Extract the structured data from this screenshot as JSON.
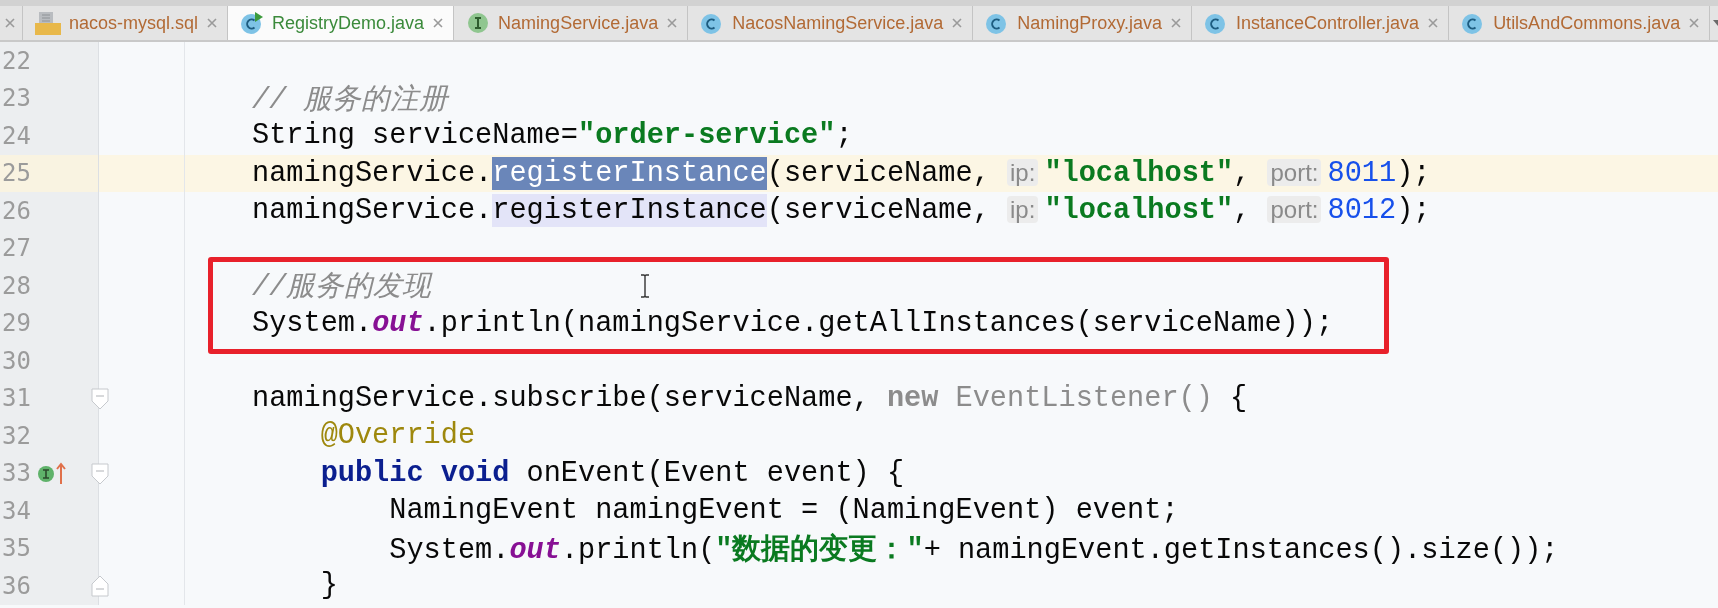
{
  "tabs": [
    {
      "label": "nacos-mysql.sql",
      "kind": "sql",
      "selected": false,
      "runnable": false,
      "color": "#b26a35"
    },
    {
      "label": "RegistryDemo.java",
      "kind": "class",
      "selected": true,
      "runnable": true,
      "color": "#3b8a3b"
    },
    {
      "label": "NamingService.java",
      "kind": "interface",
      "selected": false,
      "runnable": false,
      "color": "#b26a35"
    },
    {
      "label": "NacosNamingService.java",
      "kind": "class",
      "selected": false,
      "runnable": false,
      "color": "#b26a35"
    },
    {
      "label": "NamingProxy.java",
      "kind": "class",
      "selected": false,
      "runnable": false,
      "color": "#b26a35"
    },
    {
      "label": "InstanceController.java",
      "kind": "class",
      "selected": false,
      "runnable": false,
      "color": "#b26a35"
    },
    {
      "label": "UtilsAndCommons.java",
      "kind": "class",
      "selected": false,
      "runnable": false,
      "color": "#b26a35"
    }
  ],
  "editor": {
    "lines": [
      {
        "number": "22",
        "current": false,
        "boxed": false,
        "fold_start": false,
        "fold_end": false,
        "implements": false
      },
      {
        "number": "23",
        "current": false,
        "boxed": false,
        "fold_start": false,
        "fold_end": false,
        "implements": false,
        "tokens": [
          {
            "kind": "comment",
            "text": "// 服务的注册"
          }
        ]
      },
      {
        "number": "24",
        "current": false,
        "boxed": false,
        "fold_start": false,
        "fold_end": false,
        "implements": false,
        "tokens": [
          {
            "kind": "plain",
            "text": "String serviceName="
          },
          {
            "kind": "string",
            "text": "\"order-service\""
          },
          {
            "kind": "plain",
            "text": ";"
          }
        ]
      },
      {
        "number": "25",
        "current": true,
        "boxed": false,
        "fold_start": false,
        "fold_end": false,
        "implements": false,
        "tokens": [
          {
            "kind": "plain",
            "text": "namingService."
          },
          {
            "kind": "selected",
            "text": "registerInstance"
          },
          {
            "kind": "plain",
            "text": "(serviceName, "
          },
          {
            "kind": "hint",
            "text": "ip:"
          },
          {
            "kind": "string",
            "text": "\"localhost\""
          },
          {
            "kind": "plain",
            "text": ", "
          },
          {
            "kind": "hint",
            "text": "port:"
          },
          {
            "kind": "number",
            "text": "8011"
          },
          {
            "kind": "plain",
            "text": ");"
          }
        ]
      },
      {
        "number": "26",
        "current": false,
        "boxed": false,
        "fold_start": false,
        "fold_end": false,
        "implements": false,
        "tokens": [
          {
            "kind": "plain",
            "text": "namingService."
          },
          {
            "kind": "usage",
            "text": "registerInstance"
          },
          {
            "kind": "plain",
            "text": "(serviceName, "
          },
          {
            "kind": "hint",
            "text": "ip:"
          },
          {
            "kind": "string",
            "text": "\"localhost\""
          },
          {
            "kind": "plain",
            "text": ", "
          },
          {
            "kind": "hint",
            "text": "port:"
          },
          {
            "kind": "number",
            "text": "8012"
          },
          {
            "kind": "plain",
            "text": ");"
          }
        ]
      },
      {
        "number": "27",
        "current": false,
        "boxed": false,
        "fold_start": false,
        "fold_end": false,
        "implements": false
      },
      {
        "number": "28",
        "current": false,
        "boxed": true,
        "fold_start": false,
        "fold_end": false,
        "implements": false,
        "tokens": [
          {
            "kind": "comment",
            "text": "//服务的发现"
          }
        ]
      },
      {
        "number": "29",
        "current": false,
        "boxed": true,
        "fold_start": false,
        "fold_end": false,
        "implements": false,
        "tokens": [
          {
            "kind": "plain",
            "text": "System."
          },
          {
            "kind": "static",
            "text": "out"
          },
          {
            "kind": "plain",
            "text": ".println(namingService.getAllInstances(serviceName));"
          }
        ]
      },
      {
        "number": "30",
        "current": false,
        "boxed": false,
        "fold_start": false,
        "fold_end": false,
        "implements": false
      },
      {
        "number": "31",
        "current": false,
        "boxed": false,
        "fold_start": true,
        "fold_end": false,
        "implements": false,
        "tokens": [
          {
            "kind": "plain",
            "text": "namingService.subscribe(serviceName, "
          },
          {
            "kind": "muted-keyword",
            "text": "new"
          },
          {
            "kind": "muted",
            "text": " EventListener()"
          },
          {
            "kind": "plain",
            "text": " {"
          }
        ]
      },
      {
        "number": "32",
        "current": false,
        "boxed": false,
        "fold_start": false,
        "fold_end": false,
        "implements": false,
        "tokens": [
          {
            "kind": "annotation",
            "text": "    @Override"
          }
        ]
      },
      {
        "number": "33",
        "current": false,
        "boxed": false,
        "fold_start": true,
        "fold_end": false,
        "implements": true,
        "tokens": [
          {
            "kind": "keyword",
            "text": "    public void"
          },
          {
            "kind": "plain",
            "text": " onEvent(Event event) {"
          }
        ]
      },
      {
        "number": "34",
        "current": false,
        "boxed": false,
        "fold_start": false,
        "fold_end": false,
        "implements": false,
        "tokens": [
          {
            "kind": "plain",
            "text": "        NamingEvent namingEvent = (NamingEvent) event;"
          }
        ]
      },
      {
        "number": "35",
        "current": false,
        "boxed": false,
        "fold_start": false,
        "fold_end": false,
        "implements": false,
        "tokens": [
          {
            "kind": "plain",
            "text": "        System."
          },
          {
            "kind": "static",
            "text": "out"
          },
          {
            "kind": "plain",
            "text": ".println("
          },
          {
            "kind": "string",
            "text": "\"数据的变更：\""
          },
          {
            "kind": "plain",
            "text": "+ namingEvent.getInstances().size());"
          }
        ]
      },
      {
        "number": "36",
        "current": false,
        "boxed": false,
        "fold_start": false,
        "fold_end": true,
        "implements": false,
        "tokens": [
          {
            "kind": "plain",
            "text": "    }"
          }
        ]
      }
    ],
    "highlight_box": {
      "color": "#e8212b"
    }
  }
}
